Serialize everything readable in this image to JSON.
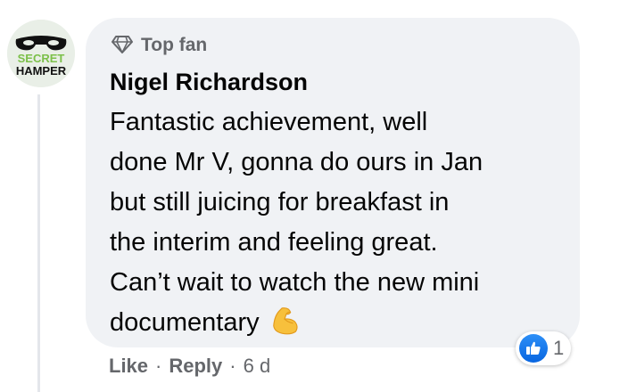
{
  "avatar": {
    "text_line1": "SECRET",
    "text_line2": "HAMPER"
  },
  "badge": {
    "icon": "diamond-icon",
    "label": "Top fan"
  },
  "comment": {
    "author": "Nigel Richardson",
    "lines": [
      "Fantastic achievement, well",
      "done Mr V, gonna do ours in Jan",
      "but still juicing for breakfast in",
      "the interim and feeling great.",
      "Can’t wait to watch the new mini",
      "documentary"
    ],
    "emoji": "flexed-biceps-emoji"
  },
  "reactions": {
    "icon": "like-icon",
    "count": "1"
  },
  "actions": {
    "like": "Like",
    "separator": "·",
    "reply": "Reply",
    "time": "6 d"
  },
  "colors": {
    "bubble": "#f0f2f5",
    "meta": "#65676b",
    "text": "#050505",
    "like_blue": "#1877f2"
  }
}
